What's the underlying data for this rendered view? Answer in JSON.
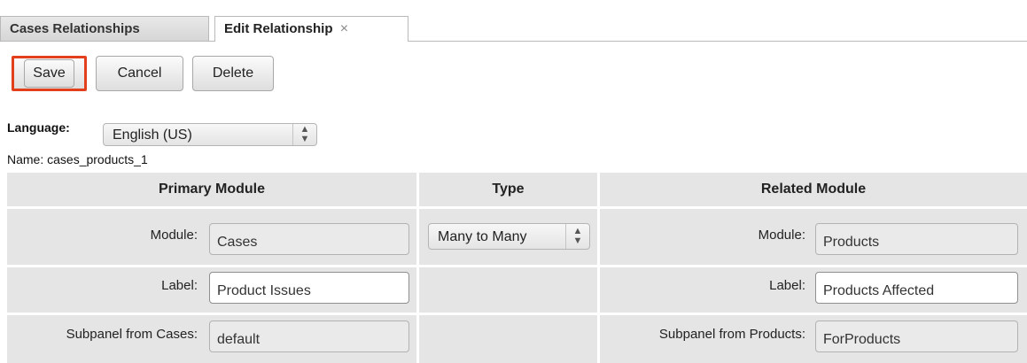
{
  "tabs": {
    "first": "Cases Relationships",
    "second": "Edit Relationship",
    "close_glyph": "×"
  },
  "buttons": {
    "save": "Save",
    "cancel": "Cancel",
    "delete": "Delete"
  },
  "language": {
    "label": "Language:",
    "selected": "English (US)"
  },
  "name_line": "Name: cases_products_1",
  "table": {
    "primary_header": "Primary Module",
    "type_header": "Type",
    "related_header": "Related Module",
    "type_value": "Many to Many",
    "primary": {
      "module_label": "Module:",
      "module_value": "Cases",
      "label_label": "Label:",
      "label_value": "Product Issues",
      "subpanel_label": "Subpanel from Cases:",
      "subpanel_value": "default"
    },
    "related": {
      "module_label": "Module:",
      "module_value": "Products",
      "label_label": "Label:",
      "label_value": "Products Affected",
      "subpanel_label": "Subpanel from Products:",
      "subpanel_value": "ForProducts"
    }
  },
  "colors": {
    "save_highlight": "#e2401c",
    "table_bg": "#e5e5e5"
  }
}
